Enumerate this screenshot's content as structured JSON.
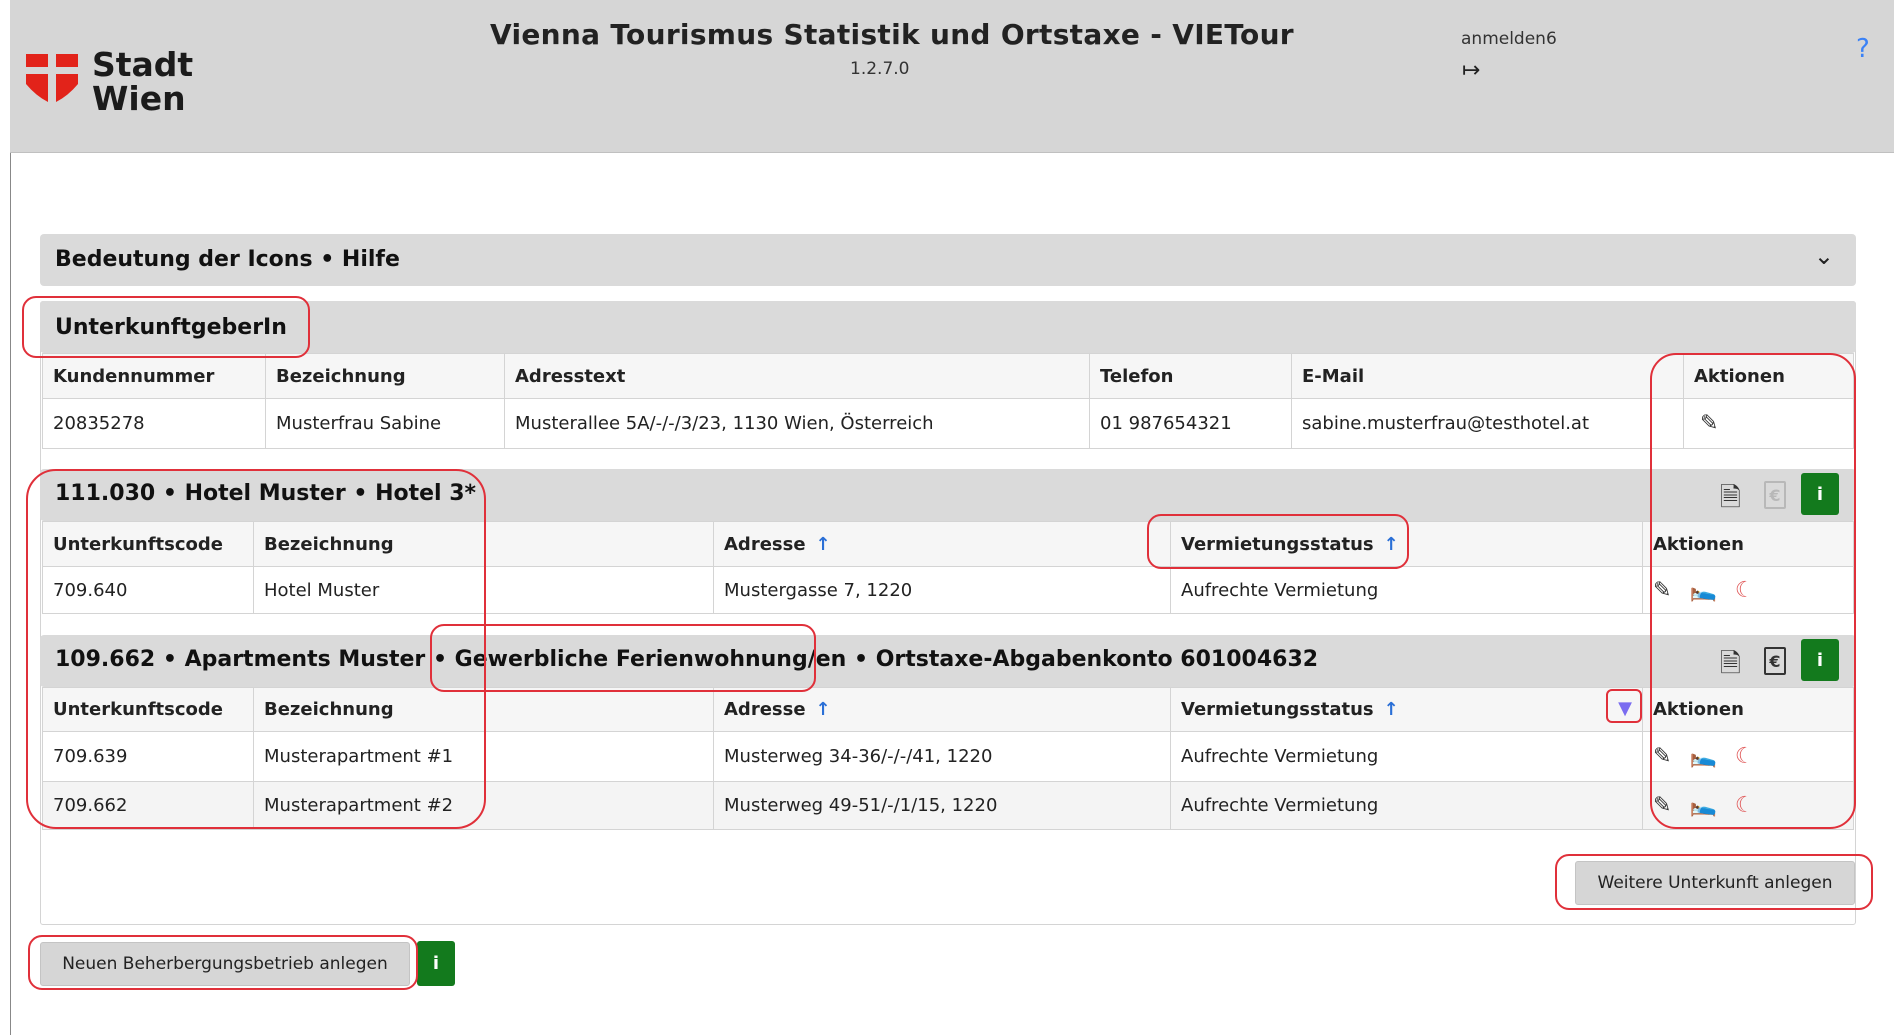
{
  "header": {
    "logo_text_line1": "Stadt",
    "logo_text_line2": "Wien",
    "app_title": "Vienna Tourismus Statistik und Ortstaxe - VIETour",
    "version": "1.2.7.0",
    "username": "anmelden6",
    "logout_icon": "logout-icon",
    "help": "?"
  },
  "help_panel": {
    "title": "Bedeutung der Icons • Hilfe",
    "chevron": "⌄"
  },
  "host": {
    "title": "UnterkunftgeberIn",
    "columns": [
      "Kundennummer",
      "Bezeichnung",
      "Adresstext",
      "Telefon",
      "E-Mail",
      "Aktionen"
    ],
    "row": [
      "20835278",
      "Musterfrau Sabine",
      "Musterallee 5A/-/-/3/23, 1130 Wien, Österreich",
      "01 987654321",
      "sabine.musterfrau@testhotel.at"
    ]
  },
  "business1": {
    "title": "111.030 • Hotel Muster • Hotel 3*",
    "columns": [
      "Unterkunftscode",
      "Bezeichnung",
      "Adresse",
      "Vermietungsstatus",
      "Aktionen"
    ],
    "rows": [
      [
        "709.640",
        "Hotel Muster",
        "Mustergasse 7, 1220",
        "Aufrechte Vermietung"
      ]
    ],
    "info_label": "i"
  },
  "business2": {
    "title": "109.662 • Apartments Muster • Gewerbliche Ferienwohnung/en • Ortstaxe-Abgabenkonto 601004632",
    "columns": [
      "Unterkunftscode",
      "Bezeichnung",
      "Adresse",
      "Vermietungsstatus",
      "Aktionen"
    ],
    "rows": [
      [
        "709.639",
        "Musterapartment #1",
        "Musterweg 34-36/-/-/41, 1220",
        "Aufrechte Vermietung"
      ],
      [
        "709.662",
        "Musterapartment #2",
        "Musterweg 49-51/-/1/15, 1220",
        "Aufrechte Vermietung"
      ]
    ],
    "info_label": "i"
  },
  "buttons": {
    "add_accommodation": "Weitere Unterkunft anlegen",
    "add_business": "Neuen Beherbergungsbetrieb anlegen",
    "info_label": "i"
  },
  "colors": {
    "accent_green": "#137a1d",
    "highlight_red": "#e0303a",
    "sort_blue": "#2a6fd6"
  }
}
